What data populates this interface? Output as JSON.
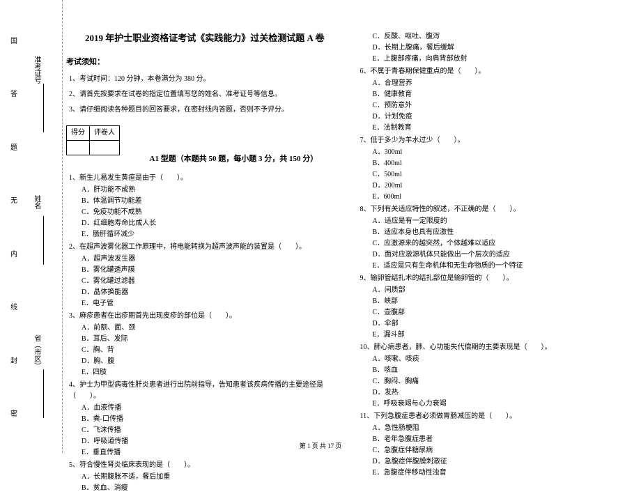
{
  "sidebar": {
    "seal_chars": [
      "国",
      "答",
      "题",
      "无",
      "内",
      "线",
      "封",
      "密"
    ],
    "fields": [
      "准考证号",
      "姓名",
      "省（市区）"
    ]
  },
  "header": {
    "title": "2019 年护士职业资格证考试《实践能力》过关检测试题 A 卷",
    "notice_heading": "考试须知：",
    "notices": [
      "1、考试时间：120 分钟，本卷满分为 380 分。",
      "2、请首先按要求在试卷的指定位置填写您的姓名、准考证号等信息。",
      "3、请仔细阅读各种题目的回答要求，在密封线内答题，否则不予评分。"
    ],
    "score_labels": [
      "得分",
      "评卷人"
    ],
    "section_title": "A1 型题（本题共 50 题，每小题 3 分，共 150 分）"
  },
  "questions_left": [
    {
      "num": "1、",
      "stem": "新生儿易发生黄疸是由于（　　）。",
      "opts": [
        "A．肝功能不成熟",
        "B．体温调节功能差",
        "C．免疫功能不成熟",
        "D．红细胞寿命比成人长",
        "E．肠肝循环减少"
      ]
    },
    {
      "num": "2、",
      "stem": "在超声波雾化器工作原理中，将电能转换为超声波声能的装置是（　　）。",
      "opts": [
        "A．超声波发生器",
        "B．雾化罐透声膜",
        "C．雾化罐过滤器",
        "D．晶体换能器",
        "E．电子管"
      ]
    },
    {
      "num": "3、",
      "stem": "麻疹患者在出疹期首先出现皮疹的部位是（　　）。",
      "opts": [
        "A．前额、面、颈",
        "B．耳后、发际",
        "C．胸、背",
        "D．胸、腹",
        "E．四肢"
      ]
    },
    {
      "num": "4、",
      "stem": "护士为甲型病毒性肝炎患者进行出院前指导，告知患者该疾病传播的主要途径是（　　）。",
      "opts": [
        "A．血液传播",
        "B．粪-口传播",
        "C．飞沫传播",
        "D．呼吸道传播",
        "E．垂直传播"
      ]
    },
    {
      "num": "5、",
      "stem": "符合慢性肾炎临床表现的是（　　）。",
      "opts": [
        "A．长期腹胀不适，餐后加重",
        "B．贫血、消瘦"
      ]
    }
  ],
  "questions_right_pre": [
    "C．反酸、呕吐、腹泻",
    "D．长期上腹痛，餐后缓解",
    "E．上腹部疼痛，向肩背部放射"
  ],
  "questions_right": [
    {
      "num": "6、",
      "stem": "不属于青春期保健重点的是（　　）。",
      "opts": [
        "A．合理营养",
        "B．健康教育",
        "C．预防意外",
        "D．计划免疫",
        "E．法制教育"
      ]
    },
    {
      "num": "7、",
      "stem": "低于多少为羊水过少（　　）。",
      "opts": [
        "A．300ml",
        "B．400ml",
        "C．500ml",
        "D．200ml",
        "E．600ml"
      ]
    },
    {
      "num": "8、",
      "stem": "下列有关适应特性的叙述，不正确的是（　　）。",
      "opts": [
        "A．适应是有一定限度的",
        "B．适应本身也具有应激性",
        "C．应激源来的越突然，个体越难以适应",
        "D．面对应激源机体只能做出一个层次的适应",
        "E．适应是只有生命机体和无生命物质的一个特征"
      ]
    },
    {
      "num": "9、",
      "stem": "输卵管结扎术的结扎部位是输卵管的（　　）。",
      "opts": [
        "A．间质部",
        "B．峡部",
        "C．壶腹部",
        "D．伞部",
        "E．漏斗部"
      ]
    },
    {
      "num": "10、",
      "stem": "肺心病患者，肺、心功能失代偿期的主要表现是（　　）。",
      "opts": [
        "A．咳嗽、咳痰",
        "B．咳血",
        "C．胸闷、胸痛",
        "D．发热",
        "E．呼吸衰竭与心力衰竭"
      ]
    },
    {
      "num": "11、",
      "stem": "下列急腹症患者必须做胃肠减压的是（　　）。",
      "opts": [
        "A．急性肠梗阻",
        "B．老年急腹症患者",
        "C．急腹症伴糖尿病",
        "D．急腹症伴腹膜刺激征",
        "E．急腹症伴移动性浊音"
      ]
    }
  ],
  "footer": "第 1 页 共 17 页"
}
